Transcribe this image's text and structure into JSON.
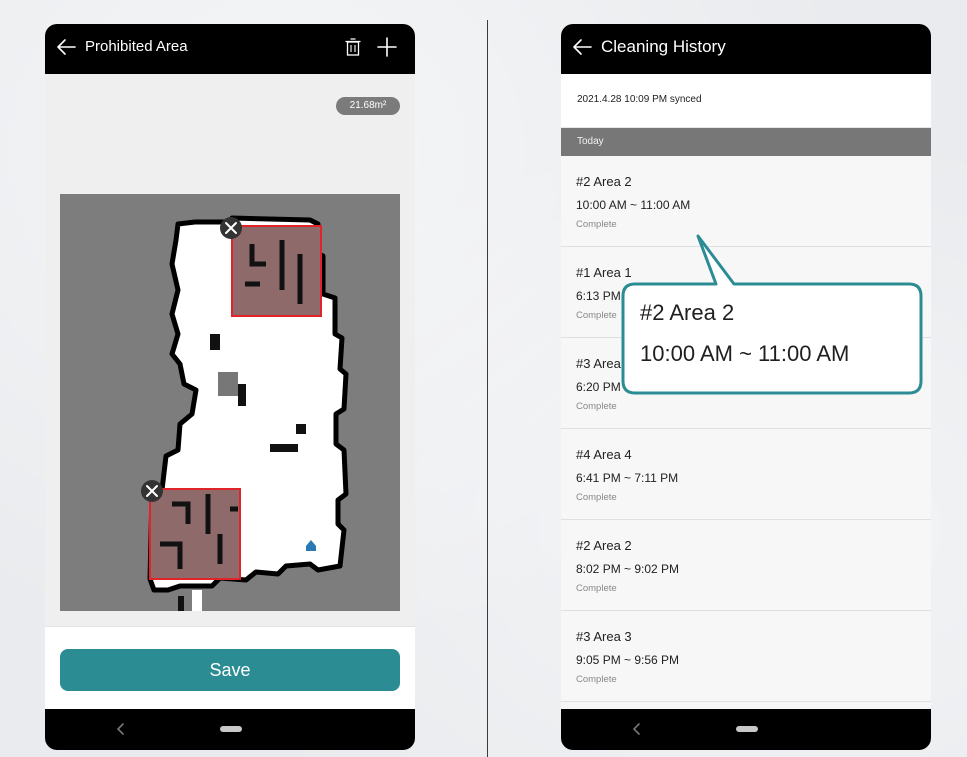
{
  "left_screen": {
    "title": "Prohibited Area",
    "icons": {
      "back": "arrow-left-icon",
      "delete": "trash-icon",
      "add": "plus-icon"
    },
    "area_badge": "21.68m²",
    "save_label": "Save",
    "accent_color": "#2b8c93",
    "zone_fill_color": "#8f6a6a",
    "zone_border_color": "#e0242a"
  },
  "right_screen": {
    "title": "Cleaning History",
    "synced_text": "2021.4.28 10:09 PM synced",
    "section_label": "Today",
    "records": [
      {
        "name": "#2 Area 2",
        "time": "10:00 AM ~ 11:00 AM",
        "status": "Complete"
      },
      {
        "name": "#1 Area 1",
        "time": "6:13 PM",
        "status": "Complete"
      },
      {
        "name": "#3 Area",
        "time": "6:20 PM",
        "status": "Complete"
      },
      {
        "name": "#4 Area 4",
        "time": "6:41 PM ~ 7:11 PM",
        "status": "Complete"
      },
      {
        "name": "#2 Area 2",
        "time": "8:02 PM ~ 9:02 PM",
        "status": "Complete"
      },
      {
        "name": "#3 Area 3",
        "time": "9:05 PM ~ 9:56 PM",
        "status": "Complete"
      }
    ]
  },
  "callout": {
    "name": "#2 Area 2",
    "time": "10:00 AM ~ 11:00 AM",
    "color": "#2b8c93"
  }
}
